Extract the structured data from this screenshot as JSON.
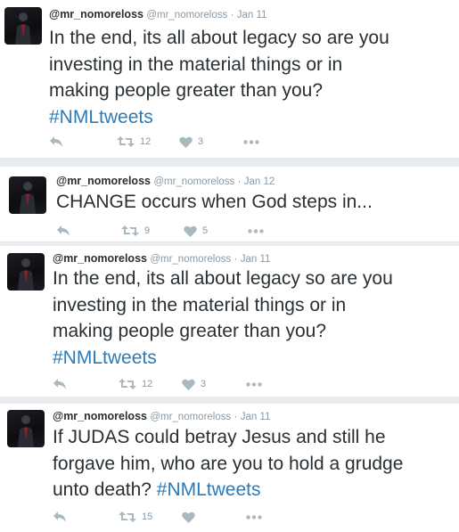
{
  "colors": {
    "background": "#e9edf0",
    "card": "#ffffff",
    "text": "#292f33",
    "meta": "#8899a6",
    "hashtag": "#2b7bb9",
    "icon": "#aab8c2"
  },
  "tweets": [
    {
      "name": "@mr_nomoreloss",
      "handle": "@mr_nomoreloss",
      "dot": "·",
      "time": "Jan 11",
      "lines": [
        "In the end, its all about legacy so are you",
        "investing in the material things or in",
        "making people greater than you?"
      ],
      "hashtag": "#NMLtweets",
      "retweets": "12",
      "likes": "3"
    },
    {
      "name": "@mr_nomoreloss",
      "handle": "@mr_nomoreloss",
      "dot": "·",
      "time": "Jan 12",
      "lines": [
        "CHANGE occurs when God steps in..."
      ],
      "hashtag": "",
      "retweets": "9",
      "likes": "5"
    },
    {
      "name": "@mr_nomoreloss",
      "handle": "@mr_nomoreloss",
      "dot": "·",
      "time": "Jan 11",
      "lines": [
        "In the end, its all about legacy so are you",
        "investing in the material things or in",
        "making people greater than you?"
      ],
      "hashtag": "#NMLtweets",
      "retweets": "12",
      "likes": "3"
    },
    {
      "name": "@mr_nomoreloss",
      "handle": "@mr_nomoreloss",
      "dot": "·",
      "time": "Jan 11",
      "lines": [
        "If JUDAS could betray Jesus and still he",
        "forgave him, who are you to hold a grudge"
      ],
      "last_line_prefix": "unto death? ",
      "hashtag": "#NMLtweets",
      "retweets": "15",
      "likes": ""
    }
  ]
}
